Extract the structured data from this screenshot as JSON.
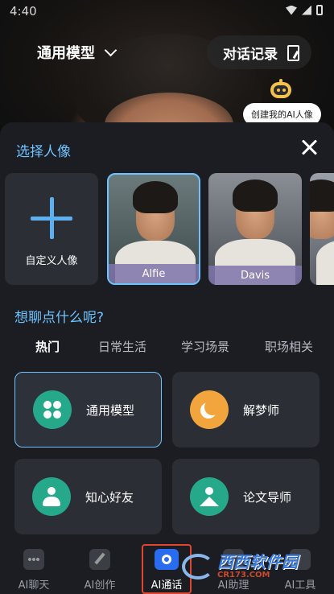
{
  "status_bar": {
    "time": "4:40"
  },
  "header": {
    "model_label": "通用模型",
    "history_label": "对话记录",
    "create_avatar_label": "创建我的AI人像"
  },
  "avatar_sheet": {
    "title": "选择人像",
    "custom_label": "自定义人像",
    "portraits": [
      {
        "name": "Alfie",
        "selected": true
      },
      {
        "name": "Davis",
        "selected": false
      }
    ]
  },
  "topics": {
    "question": "想聊点什么呢?",
    "tabs": [
      "热门",
      "日常生活",
      "学习场景",
      "职场相关"
    ],
    "active_tab": "热门",
    "cards": [
      {
        "label": "通用模型",
        "icon": "clover-icon",
        "color": "#26a98a",
        "selected": true
      },
      {
        "label": "解梦师",
        "icon": "moon-icon",
        "color": "#f3a53d",
        "selected": false
      },
      {
        "label": "知心好友",
        "icon": "friend-icon",
        "color": "#26a98a",
        "selected": false
      },
      {
        "label": "论文导师",
        "icon": "mentor-icon",
        "color": "#26a98a",
        "selected": false
      }
    ]
  },
  "bottom_nav": {
    "items": [
      {
        "label": "AI聊天",
        "icon": "chat-dots-icon"
      },
      {
        "label": "AI创作",
        "icon": "pen-icon"
      },
      {
        "label": "AI通话",
        "icon": "call-icon",
        "active": true
      },
      {
        "label": "AI助理",
        "icon": "assistant-icon"
      },
      {
        "label": "AI工具",
        "icon": "tools-icon"
      }
    ]
  },
  "watermark": {
    "main": "西西软件园",
    "sub": "CR173.COM"
  },
  "colors": {
    "accent": "#6ec3ff",
    "green": "#26a98a",
    "orange": "#f3a53d",
    "active_nav": "#2a6cf0",
    "highlight_frame": "#e0452d"
  }
}
